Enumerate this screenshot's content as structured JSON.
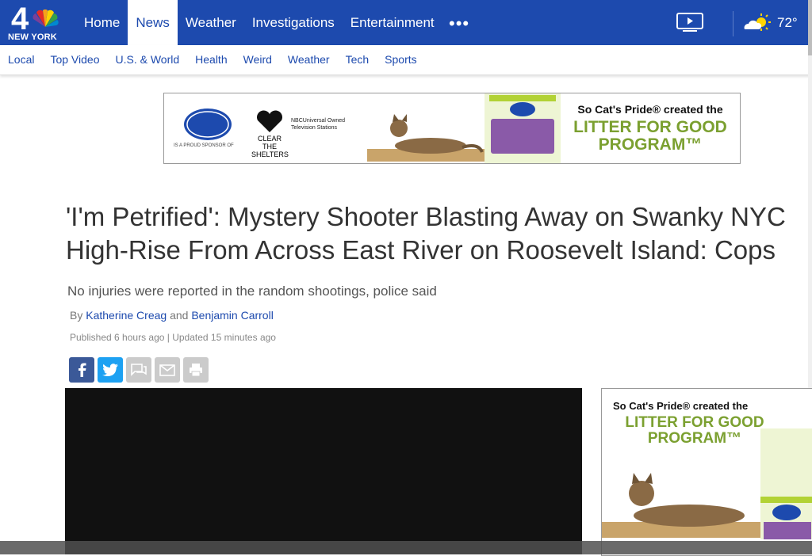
{
  "brand": {
    "logo_number": "4",
    "city": "NEW YORK"
  },
  "nav": {
    "items": [
      "Home",
      "News",
      "Weather",
      "Investigations",
      "Entertainment"
    ],
    "active": "News",
    "more": "•••"
  },
  "weather": {
    "temp": "72°"
  },
  "subnav": [
    "Local",
    "Top Video",
    "U.S. & World",
    "Health",
    "Weird",
    "Weather",
    "Tech",
    "Sports"
  ],
  "ad": {
    "sponsor": "IS A PROUD SPONSOR OF",
    "partner": "CLEAR THE SHELTERS",
    "network": "NBCUniversal Owned Television Stations",
    "headline_1": "So Cat's Pride® created the",
    "headline_2": "LITTER FOR GOOD PROGRAM™"
  },
  "article": {
    "headline": "'I'm Petrified': Mystery Shooter Blasting Away on Swanky NYC High-Rise From Across East River on Roosevelt Island: Cops",
    "dek": "No injuries were reported in the random shootings, police said",
    "by": "By",
    "author_1": "Katherine Creag",
    "and": "and",
    "author_2": "Benjamin Carroll",
    "dates": "Published 6 hours ago | Updated 15 minutes ago"
  },
  "share": [
    "facebook-icon",
    "twitter-icon",
    "comment-icon",
    "email-icon",
    "print-icon"
  ],
  "colors": {
    "brand_blue": "#1d4aae",
    "ad_green": "#7ba030",
    "facebook": "#3b5998",
    "twitter": "#1da1f2"
  }
}
